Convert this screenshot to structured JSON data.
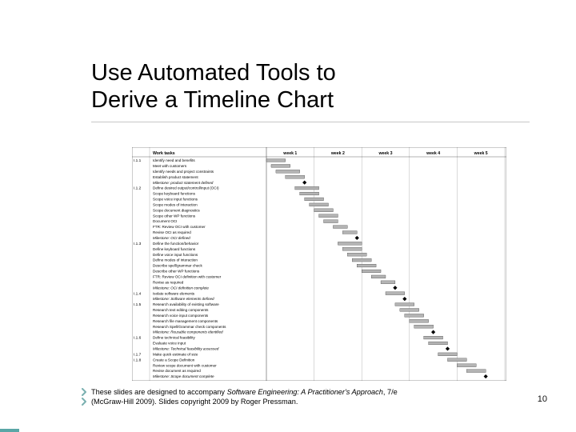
{
  "slide": {
    "title_line1": "Use Automated Tools to",
    "title_line2": "Derive a Timeline Chart",
    "page_number": "10"
  },
  "footer": {
    "line1_pre": "These slides are designed to accompany ",
    "book_title": "Software Engineering: A Practitioner's Approach",
    "line1_post": ", 7/e",
    "line2": "(McGraw-Hill 2009). Slides copyright 2009 by Roger Pressman."
  },
  "chart": {
    "header_left": "Work tasks",
    "week_labels": [
      "week 1",
      "week 2",
      "week 3",
      "week 4",
      "week 5"
    ],
    "groups": [
      {
        "idx": "I.1.1",
        "tasks": [
          {
            "t": "Identify need and benefits",
            "s": 0,
            "d": 8
          },
          {
            "t": "Meet with customers",
            "s": 2,
            "d": 8
          },
          {
            "t": "Identify needs and project constraints",
            "s": 4,
            "d": 10
          },
          {
            "t": "Establish product statement",
            "s": 8,
            "d": 8
          },
          {
            "t": "Milestone: product statement defined",
            "ms": 16
          }
        ]
      },
      {
        "idx": "I.1.2",
        "tasks": [
          {
            "t": "Define desired output/control/input (OCI)",
            "s": 12,
            "d": 10
          },
          {
            "t": "Scope keyboard functions",
            "s": 14,
            "d": 8
          },
          {
            "t": "Scope voice input functions",
            "s": 16,
            "d": 8
          },
          {
            "t": "Scope modes of interaction",
            "s": 18,
            "d": 8
          },
          {
            "t": "Scope document diagnostics",
            "s": 20,
            "d": 8
          },
          {
            "t": "Scope other WP functions",
            "s": 22,
            "d": 8
          },
          {
            "t": "Document OCI",
            "s": 24,
            "d": 6
          },
          {
            "t": "FTR: Review OCI with customer",
            "s": 28,
            "d": 6
          },
          {
            "t": "Revise OCI as required",
            "s": 32,
            "d": 6
          },
          {
            "t": "Milestone: OCI defined",
            "ms": 38
          }
        ]
      },
      {
        "idx": "I.1.3",
        "tasks": [
          {
            "t": "Define the function/behavior",
            "s": 30,
            "d": 10
          },
          {
            "t": "Define keyboard functions",
            "s": 32,
            "d": 8
          },
          {
            "t": "Define voice input functions",
            "s": 34,
            "d": 8
          },
          {
            "t": "Define modes of interaction",
            "s": 36,
            "d": 8
          },
          {
            "t": "Describe spell/grammar check",
            "s": 38,
            "d": 8
          },
          {
            "t": "Describe other WP functions",
            "s": 40,
            "d": 8
          },
          {
            "t": "FTR: Review OCI definition with customer",
            "s": 44,
            "d": 6
          },
          {
            "t": "Revise as required",
            "s": 48,
            "d": 6
          },
          {
            "t": "Milestone: OCI definition complete",
            "ms": 54
          }
        ]
      },
      {
        "idx": "I.1.4",
        "tasks": [
          {
            "t": "Isolate software elements",
            "s": 50,
            "d": 8
          },
          {
            "t": "Milestone: Software elements defined",
            "ms": 58
          }
        ]
      },
      {
        "idx": "I.1.5",
        "tasks": [
          {
            "t": "Research availability of existing software",
            "s": 54,
            "d": 8
          },
          {
            "t": "Research text editing components",
            "s": 56,
            "d": 8
          },
          {
            "t": "Research voice input components",
            "s": 58,
            "d": 8
          },
          {
            "t": "Research file management components",
            "s": 60,
            "d": 8
          },
          {
            "t": "Research Spell/Grammar check components",
            "s": 62,
            "d": 8
          },
          {
            "t": "Milestone: Reusable components identified",
            "ms": 70
          }
        ]
      },
      {
        "idx": "I.1.6",
        "tasks": [
          {
            "t": "Define technical feasibility",
            "s": 66,
            "d": 8
          },
          {
            "t": "Evaluate voice input",
            "s": 68,
            "d": 8
          },
          {
            "t": "Milestone: Technical feasibility assessed",
            "ms": 76
          }
        ]
      },
      {
        "idx": "I.1.7",
        "tasks": [
          {
            "t": "Make quick estimate of size",
            "s": 72,
            "d": 8
          }
        ]
      },
      {
        "idx": "I.1.8",
        "tasks": [
          {
            "t": "Create a Scope Definition",
            "s": 76,
            "d": 8
          },
          {
            "t": "Review scope document with customer",
            "s": 80,
            "d": 8
          },
          {
            "t": "Revise document as required",
            "s": 84,
            "d": 8
          },
          {
            "t": "Milestone: Scope document complete",
            "ms": 92
          }
        ]
      }
    ]
  }
}
